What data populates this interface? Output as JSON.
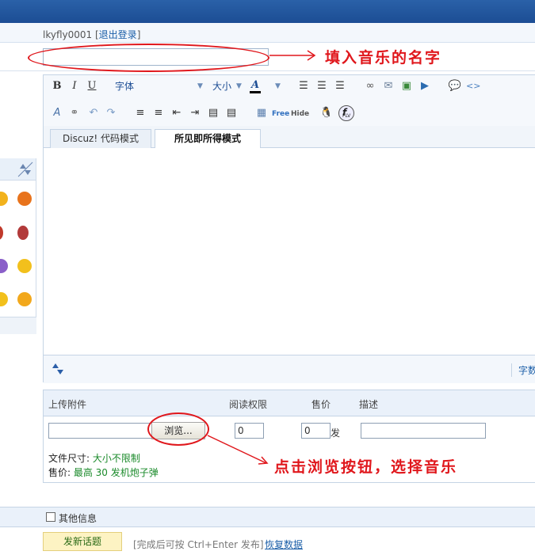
{
  "header": {
    "username": "lkyfly0001",
    "bracket_open": "[",
    "logout": "退出登录",
    "bracket_close": "]"
  },
  "annotations": {
    "title_note": "填入音乐的名字",
    "browse_note": "点击浏览按钮，选择音乐",
    "color": "#e0171c"
  },
  "toolbar": {
    "bold": "B",
    "italic": "I",
    "underline": "U",
    "font_select": "字体",
    "size_select": "大小",
    "text_color": "A",
    "free_label": "Free",
    "hide_label": "Hide",
    "flash_label": "FLV"
  },
  "tabs": [
    {
      "label": "Discuz! 代码模式"
    },
    {
      "label": "所见即所得模式"
    }
  ],
  "editor": {
    "word_count_link": "字数检"
  },
  "attachments": {
    "headers": {
      "upload": "上传附件",
      "read_perm": "阅读权限",
      "price": "售价",
      "description": "描述"
    },
    "browse_button": "浏览...",
    "read_perm_value": "0",
    "price_value": "0",
    "price_unit": "发",
    "size_label": "文件尺寸: ",
    "size_value": "大小不限制",
    "price_label": "售价: ",
    "price_rule": "最高  30 发机炮子弹"
  },
  "footer": {
    "other_info": "其他信息",
    "submit": "发新话题",
    "hint": "[完成后可按  Ctrl+Enter 发布]",
    "restore": "恢复数据"
  },
  "colors": {
    "topbar": "#1c4d94",
    "link": "#1c5fa8",
    "green": "#1a8a2a",
    "submit_bg": "#fdf3c3"
  }
}
